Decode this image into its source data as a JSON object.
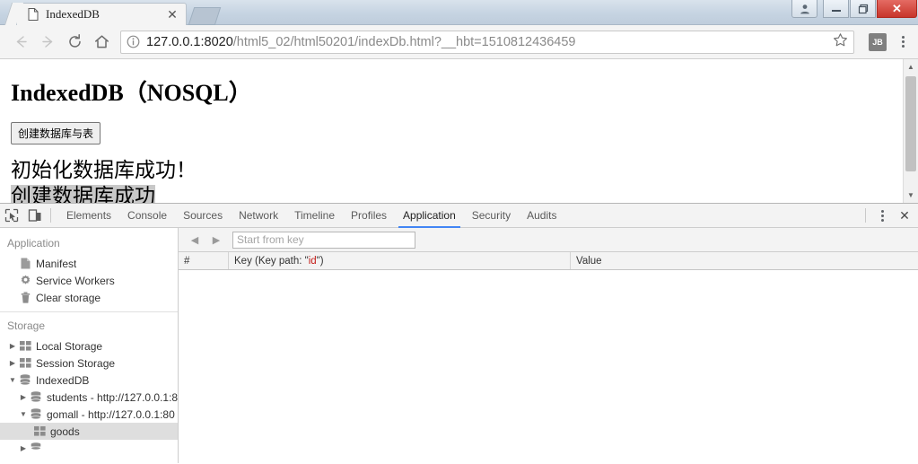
{
  "window": {
    "controls": {
      "person": "person-icon",
      "minimize": "–",
      "maximize": "❐",
      "close": "✕"
    }
  },
  "browser": {
    "tab": {
      "title": "IndexedDB",
      "favicon": "page-icon",
      "close": "✕"
    },
    "toolbar": {
      "back": "←",
      "forward": "→",
      "reload": "↻",
      "home": "⌂",
      "star": "☆",
      "extension_label": "JB"
    },
    "omnibox": {
      "info_icon": "ⓘ",
      "url_host": "127.0.0.1:8020",
      "url_path": "/html5_02/html50201/indexDb.html?__hbt=1510812436459",
      "url_full": "127.0.0.1:8020/html5_02/html50201/indexDb.html?__hbt=1510812436459"
    }
  },
  "page": {
    "heading": "IndexedDB（NOSQL）",
    "create_button": "创建数据库与表",
    "message_line1": "初始化数据库成功！",
    "message_line2": "创建数据库成功"
  },
  "devtools": {
    "tabs": [
      {
        "label": "Elements",
        "active": false
      },
      {
        "label": "Console",
        "active": false
      },
      {
        "label": "Sources",
        "active": false
      },
      {
        "label": "Network",
        "active": false
      },
      {
        "label": "Timeline",
        "active": false
      },
      {
        "label": "Profiles",
        "active": false
      },
      {
        "label": "Application",
        "active": true
      },
      {
        "label": "Security",
        "active": false
      },
      {
        "label": "Audits",
        "active": false
      }
    ],
    "active_tab": "Application",
    "active_underline_color": "#4285f4",
    "sidebar": {
      "application_section": {
        "title": "Application",
        "items": [
          {
            "label": "Manifest",
            "icon": "document-icon"
          },
          {
            "label": "Service Workers",
            "icon": "gear-icon"
          },
          {
            "label": "Clear storage",
            "icon": "trash-icon"
          }
        ]
      },
      "storage_section": {
        "title": "Storage",
        "items": [
          {
            "label": "Local Storage",
            "icon": "table-icon",
            "expanded": false,
            "twisty": "▶"
          },
          {
            "label": "Session Storage",
            "icon": "table-icon",
            "expanded": false,
            "twisty": "▶"
          },
          {
            "label": "IndexedDB",
            "icon": "database-icon",
            "expanded": true,
            "twisty": "▼"
          },
          {
            "label": "students - http://127.0.0.1:8",
            "icon": "database-icon",
            "expanded": false,
            "twisty": "▶"
          },
          {
            "label": "gomall - http://127.0.0.1:80",
            "icon": "database-icon",
            "expanded": true,
            "twisty": "▼"
          },
          {
            "label": "goods",
            "icon": "table-icon",
            "selected": true,
            "twisty": ""
          }
        ]
      }
    },
    "data_panel": {
      "prev_arrow": "◀",
      "next_arrow": "▶",
      "key_filter_placeholder": "Start from key",
      "key_filter_value": "",
      "columns": [
        {
          "label": "#"
        },
        {
          "label_prefix": "Key (Key path: \"",
          "label_keypath": "id",
          "label_suffix": "\")"
        },
        {
          "label": "Value"
        }
      ],
      "col_num": "#",
      "col_key_prefix": "Key (Key path: \"",
      "col_key_path": "id",
      "col_key_suffix": "\")",
      "col_value": "Value",
      "rows": []
    },
    "toolbar_icons": {
      "inspect": "inspect-element-icon",
      "device": "device-toolbar-icon",
      "close": "✕"
    }
  }
}
